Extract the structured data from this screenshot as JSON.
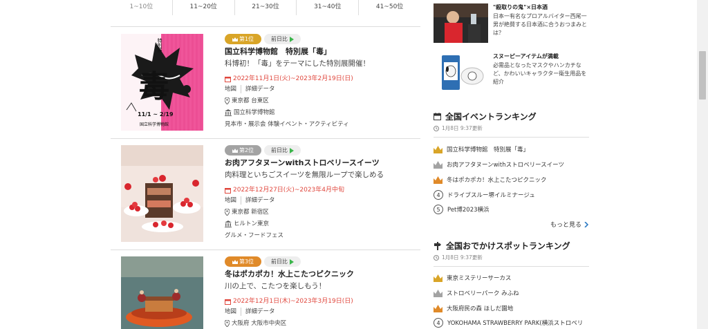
{
  "rank_tabs": [
    "1~10位",
    "11~20位",
    "21~30位",
    "31~40位",
    "41~50位"
  ],
  "items": [
    {
      "rank_label": "第1位",
      "prev_label": "前日比",
      "title": "国立科学博物館　特別展「毒」",
      "catch": "科博初！「毒」をテーマにした特別展開催！",
      "date": "2022年11月1日(火)~2023年2月19日(日)",
      "link_map": "地図",
      "link_detail": "詳細データ",
      "location": "東京都  台東区",
      "venue": "国立科学博物館",
      "categories": "見本市・展示会  体験イベント・アクティビティ"
    },
    {
      "rank_label": "第2位",
      "prev_label": "前日比",
      "title": "お肉アフタヌーンwithストロベリースイーツ",
      "catch": "肉料理といちごスイーツを無限ループで楽しめる",
      "date": "2022年12月27日(火)~2023年4月中旬",
      "link_map": "地図",
      "link_detail": "詳細データ",
      "location": "東京都  新宿区",
      "venue": "ヒルトン東京",
      "categories": "グルメ・フードフェス"
    },
    {
      "rank_label": "第3位",
      "prev_label": "前日比",
      "title": "冬はポカポカ！水上こたつピクニック",
      "catch": "川の上で、こたつを楽しもう！",
      "date": "2022年12月1日(木)~2023年3月19日(日)",
      "link_map": "地図",
      "link_detail": "詳細データ",
      "location": "大阪府  大阪市中央区"
    }
  ],
  "poster_text": {
    "kanji": "毒",
    "special": "特別展",
    "dates": "11/1 ~ 2/19",
    "venue": "国立科学博物館"
  },
  "promos": [
    {
      "title": "\"殺取りの鬼\"×日本酒",
      "desc": "日本一有名なプロアルバイター西尾一男が絶賛する日本酒に合うおつまみとは？"
    },
    {
      "title": "スヌーピーアイテムが満載",
      "desc": "必需品となったマスクやハンカチなど、かわいいキャラクター衛生用品を紹介"
    }
  ],
  "event_ranking": {
    "heading": "全国イベントランキング",
    "updated": "1月8日 9:37更新",
    "rows": [
      "国立科学博物館　特別展「毒」",
      "お肉アフタヌーンwithストロベリースイーツ",
      "冬はポカポカ！水上こたつピクニック",
      "ドライブスルー堺イルミナージュ",
      "Pet博2023横浜"
    ],
    "more": "もっと見る"
  },
  "spot_ranking": {
    "heading": "全国おでかけスポットランキング",
    "updated": "1月8日 9:37更新",
    "rows": [
      "東京ミステリーサーカス",
      "ストロベリーパーク みふね",
      "大阪府民の森 ほしだ園地",
      "YOKOHAMA STRAWBERRY PARK(横浜ストロベリ"
    ]
  },
  "colors": {
    "gold": "#d9a528",
    "silver": "#a3a3a3",
    "bronze": "#e08a29",
    "date_red": "#e0463c",
    "arrow_green": "#3ab54a"
  }
}
